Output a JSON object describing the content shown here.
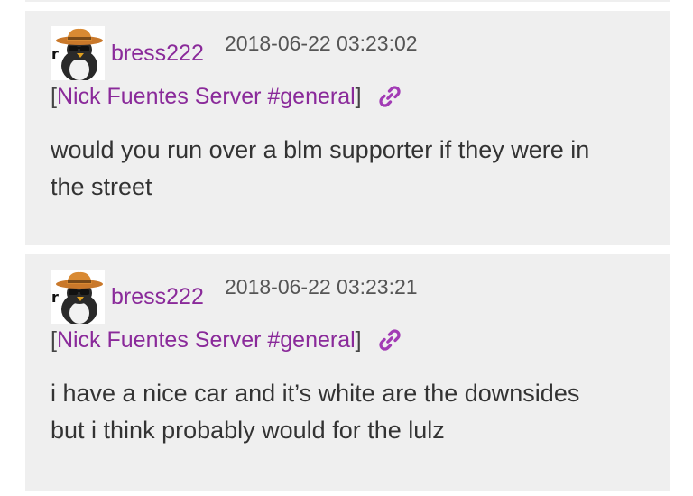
{
  "posts": [
    {
      "username": "bress222",
      "timestamp": "2018-06-22 03:23:02",
      "bracket_open": "[",
      "channel": "Nick Fuentes Server #general",
      "bracket_close": "]",
      "message_lines": [
        "would you run over a blm supporter if they were in",
        "the street"
      ],
      "avatar_icon": "penguin-cowboy-hat-avatar",
      "link_icon": "link-icon"
    },
    {
      "username": "bress222",
      "timestamp": "2018-06-22 03:23:21",
      "bracket_open": "[",
      "channel": "Nick Fuentes Server #general",
      "bracket_close": "]",
      "message_lines": [
        "i have a nice car and it’s white are the downsides",
        "but i think probably would for the lulz"
      ],
      "avatar_icon": "penguin-cowboy-hat-avatar",
      "link_icon": "link-icon"
    }
  ],
  "colors": {
    "card_bg": "#efefef",
    "username": "#8a2a9a",
    "channel": "#8a2a9a",
    "link_icon": "#a23bb5",
    "timestamp": "#555555",
    "message": "#333333"
  }
}
